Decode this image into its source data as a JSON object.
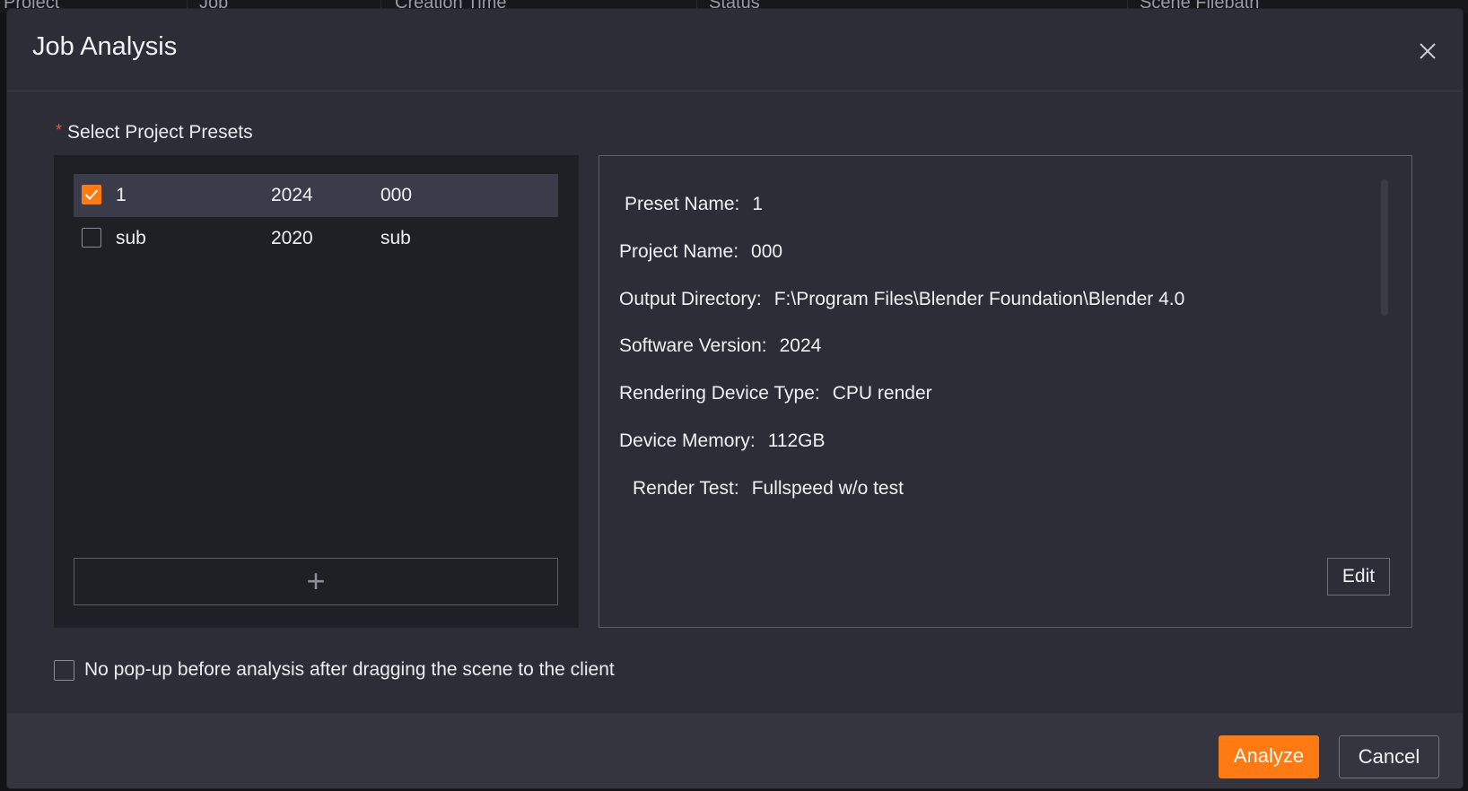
{
  "background_table": {
    "columns": [
      {
        "label": "Project"
      },
      {
        "label": "Job"
      },
      {
        "label": "Creation Time"
      },
      {
        "label": "Status"
      },
      {
        "label": "Scene Filepath"
      }
    ]
  },
  "dialog": {
    "title": "Job Analysis",
    "close_icon": "close-icon",
    "required_mark": "*",
    "section_label": "Select Project Presets",
    "presets": [
      {
        "name": "1",
        "version": "2024",
        "project": "000",
        "checked": true
      },
      {
        "name": "sub",
        "version": "2020",
        "project": "sub",
        "checked": false
      }
    ],
    "add_icon": "plus-icon",
    "add_symbol": "+",
    "details": {
      "preset_name": {
        "label": "Preset Name:",
        "value": "1"
      },
      "project_name": {
        "label": "Project Name:",
        "value": "000"
      },
      "output_directory": {
        "label": "Output Directory:",
        "value": "F:\\Program Files\\Blender Foundation\\Blender 4.0"
      },
      "software_version": {
        "label": "Software Version:",
        "value": "2024"
      },
      "rendering_device_type": {
        "label": "Rendering Device Type:",
        "value": "CPU render"
      },
      "device_memory": {
        "label": "Device Memory:",
        "value": "112GB"
      },
      "render_test": {
        "label": "Render Test:",
        "value": "Fullspeed w/o test"
      }
    },
    "edit_label": "Edit",
    "no_popup_label": "No pop-up before analysis after dragging the scene to the client",
    "no_popup_checked": false,
    "analyze_label": "Analyze",
    "cancel_label": "Cancel"
  },
  "colors": {
    "accent": "#ff7a12",
    "dialog_bg": "#2c2d36",
    "list_bg": "#1f1f26",
    "selected_row": "#3b3c4a",
    "required": "#e8523b"
  }
}
